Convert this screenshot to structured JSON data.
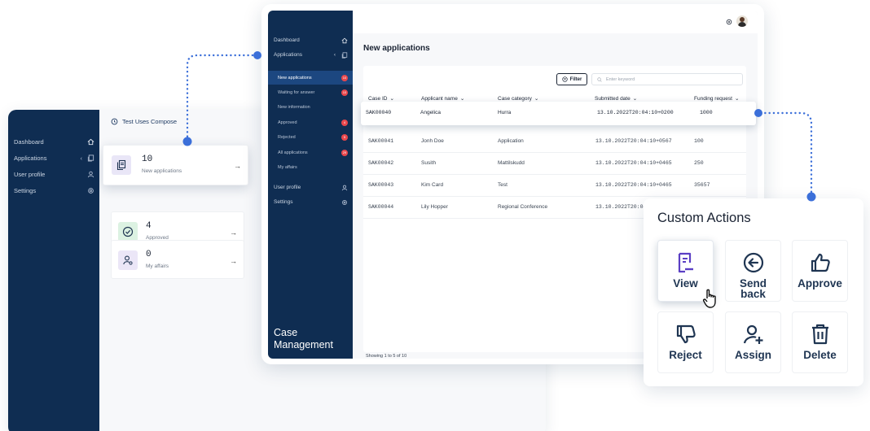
{
  "back_app": {
    "sidebar": [
      {
        "label": "Dashboard",
        "icon": "home-icon"
      },
      {
        "label": "Applications",
        "icon": "copy-icon"
      },
      {
        "label": "User profile",
        "icon": "user-icon"
      },
      {
        "label": "Settings",
        "icon": "gear-icon"
      }
    ],
    "header_title": "Test Uses Compose",
    "cards": [
      {
        "count": "10",
        "label": "New applications",
        "icon": "documents-icon"
      },
      {
        "count": "4",
        "label": "Approved",
        "icon": "check-circle-icon"
      },
      {
        "count": "0",
        "label": "My affairs",
        "icon": "user-settings-icon"
      }
    ]
  },
  "front_app": {
    "sidebar": {
      "dashboard": "Dashboard",
      "applications": "Applications",
      "sub_items": [
        {
          "label": "New applications",
          "badge": "10"
        },
        {
          "label": "Waiting for answer",
          "badge": "10"
        },
        {
          "label": "New information",
          "badge": ""
        },
        {
          "label": "Approved",
          "badge": "4"
        },
        {
          "label": "Rejected",
          "badge": "5"
        },
        {
          "label": "All applications",
          "badge": "29"
        },
        {
          "label": "My affairs",
          "badge": ""
        }
      ],
      "user_profile": "User profile",
      "settings": "Settings",
      "app_title_line1": "Case",
      "app_title_line2": "Management"
    },
    "page_title": "New applications",
    "filter_label": "Filter",
    "search_placeholder": "Enter keyword",
    "columns": [
      "Case ID",
      "Applicant name",
      "Case category",
      "Submitted date",
      "Funding request"
    ],
    "rows": [
      {
        "case_id": "SAK00040",
        "name": "Angelica",
        "category": "Hurra",
        "date": "13.10.2022T20:04:10+0200",
        "funding": "1000"
      },
      {
        "case_id": "SAK00041",
        "name": "Jonh Doe",
        "category": "Application",
        "date": "13.10.2022T20:04:10+0567",
        "funding": "100"
      },
      {
        "case_id": "SAK00042",
        "name": "Susith",
        "category": "Mattilskudd",
        "date": "13.10.2022T20:04:10+0465",
        "funding": "250"
      },
      {
        "case_id": "SAK00043",
        "name": "Kim Card",
        "category": "Test",
        "date": "13.10.2022T20:04:10+0465",
        "funding": "35657"
      },
      {
        "case_id": "SAK00044",
        "name": "Lily Hopper",
        "category": "Regional Conference",
        "date": "13.10.2022T20:04:",
        "funding": ""
      }
    ],
    "showing": "Showing 1 to 5 of 10"
  },
  "custom_actions": {
    "title": "Custom Actions",
    "actions": [
      {
        "label": "View",
        "icon": "document-icon"
      },
      {
        "label": "Send back",
        "icon": "arrow-left-circle-icon"
      },
      {
        "label": "Approve",
        "icon": "thumbs-up-icon"
      },
      {
        "label": "Reject",
        "icon": "thumbs-down-icon"
      },
      {
        "label": "Assign",
        "icon": "user-plus-icon"
      },
      {
        "label": "Delete",
        "icon": "trash-icon"
      }
    ]
  },
  "colors": {
    "sidebar": "#0f2d52",
    "active_item": "#1c4780",
    "badge": "#e8474c",
    "connector": "#3b6fd9",
    "action_icon": "#5b3fc4"
  }
}
